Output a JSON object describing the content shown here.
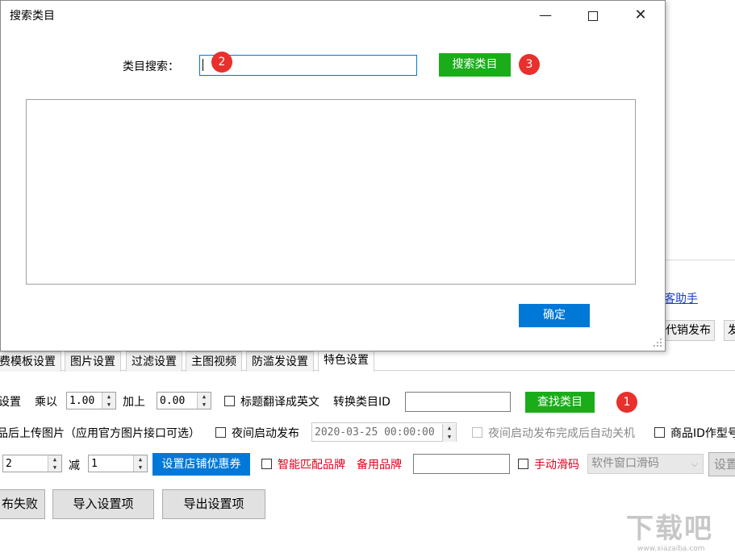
{
  "dialog": {
    "title": "搜索类目",
    "search_label": "类目搜索：",
    "search_value": "",
    "search_button": "搜索类目",
    "ok_button": "确定",
    "badge_2": "2",
    "badge_3": "3"
  },
  "background": {
    "right_link": "客助手",
    "right_tabs": [
      "代销发布",
      "发"
    ],
    "tabs": [
      "费模板设置",
      "图片设置",
      "过滤设置",
      "主图视频",
      "防滥发设置",
      "特色设置"
    ],
    "active_tab": "特色设置",
    "row1": {
      "settings_label": "设置",
      "multiply_label": "乘以",
      "multiply_value": "1.00",
      "add_label": "加上",
      "add_value": "0.00",
      "translate_title": "标题翻译成英文",
      "convert_id_label": "转换类目ID",
      "convert_id_value": "",
      "find_button": "查找类目",
      "badge_1": "1"
    },
    "row2": {
      "upload_images": "品后上传图片（应用官方图片接口可选）",
      "night_publish": "夜间启动发布",
      "datetime": "2020-03-25 00:00:00",
      "night_shutdown": "夜间启动发布完成后自动关机",
      "product_id": "商品ID作型号"
    },
    "row3": {
      "value_a": "2",
      "minus_label": "减",
      "value_b": "1",
      "coupon_button": "设置店铺优惠券",
      "smart_brand": "智能匹配品牌",
      "backup_brand": "备用品牌",
      "backup_brand_value": "",
      "manual_slide": "手动滑码",
      "slide_select": "软件窗口滑码",
      "settings_button_partial": "设置"
    },
    "row4": {
      "fail_button_partial": "布失败",
      "import_button": "导入设置项",
      "export_button": "导出设置项"
    }
  },
  "watermark": {
    "text": "下载吧",
    "url": "www.xiazaiba.com"
  }
}
